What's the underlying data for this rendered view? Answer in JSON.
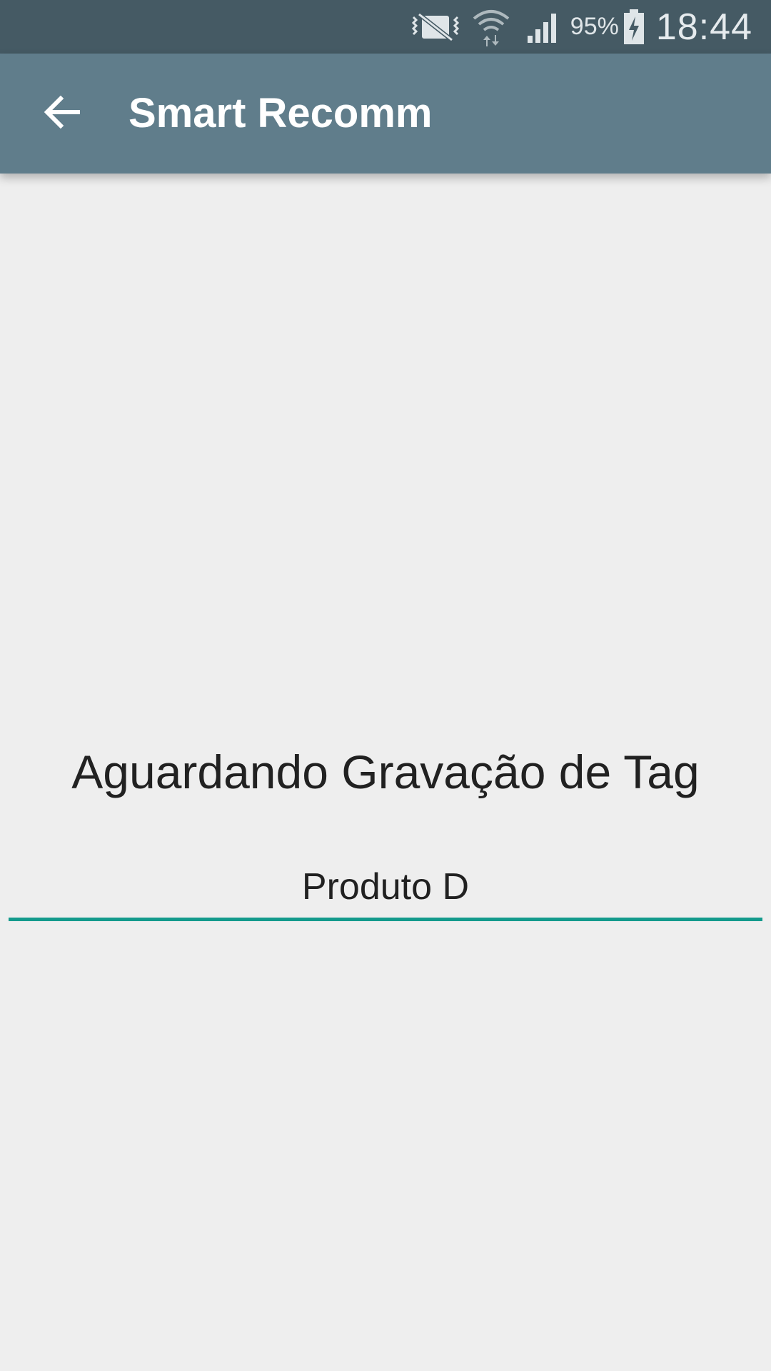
{
  "status_bar": {
    "icons": [
      "vibrate-icon",
      "wifi-icon",
      "signal-icon",
      "battery-charging-icon"
    ],
    "battery_percent": "95%",
    "time": "18:44"
  },
  "app_bar": {
    "back_icon": "arrow-back-icon",
    "title": "Smart Recomm",
    "color": "#607d8b"
  },
  "main": {
    "heading": "Aguardando Gravação de Tag",
    "product_field_value": "Produto D",
    "accent_color": "#139a8c"
  }
}
